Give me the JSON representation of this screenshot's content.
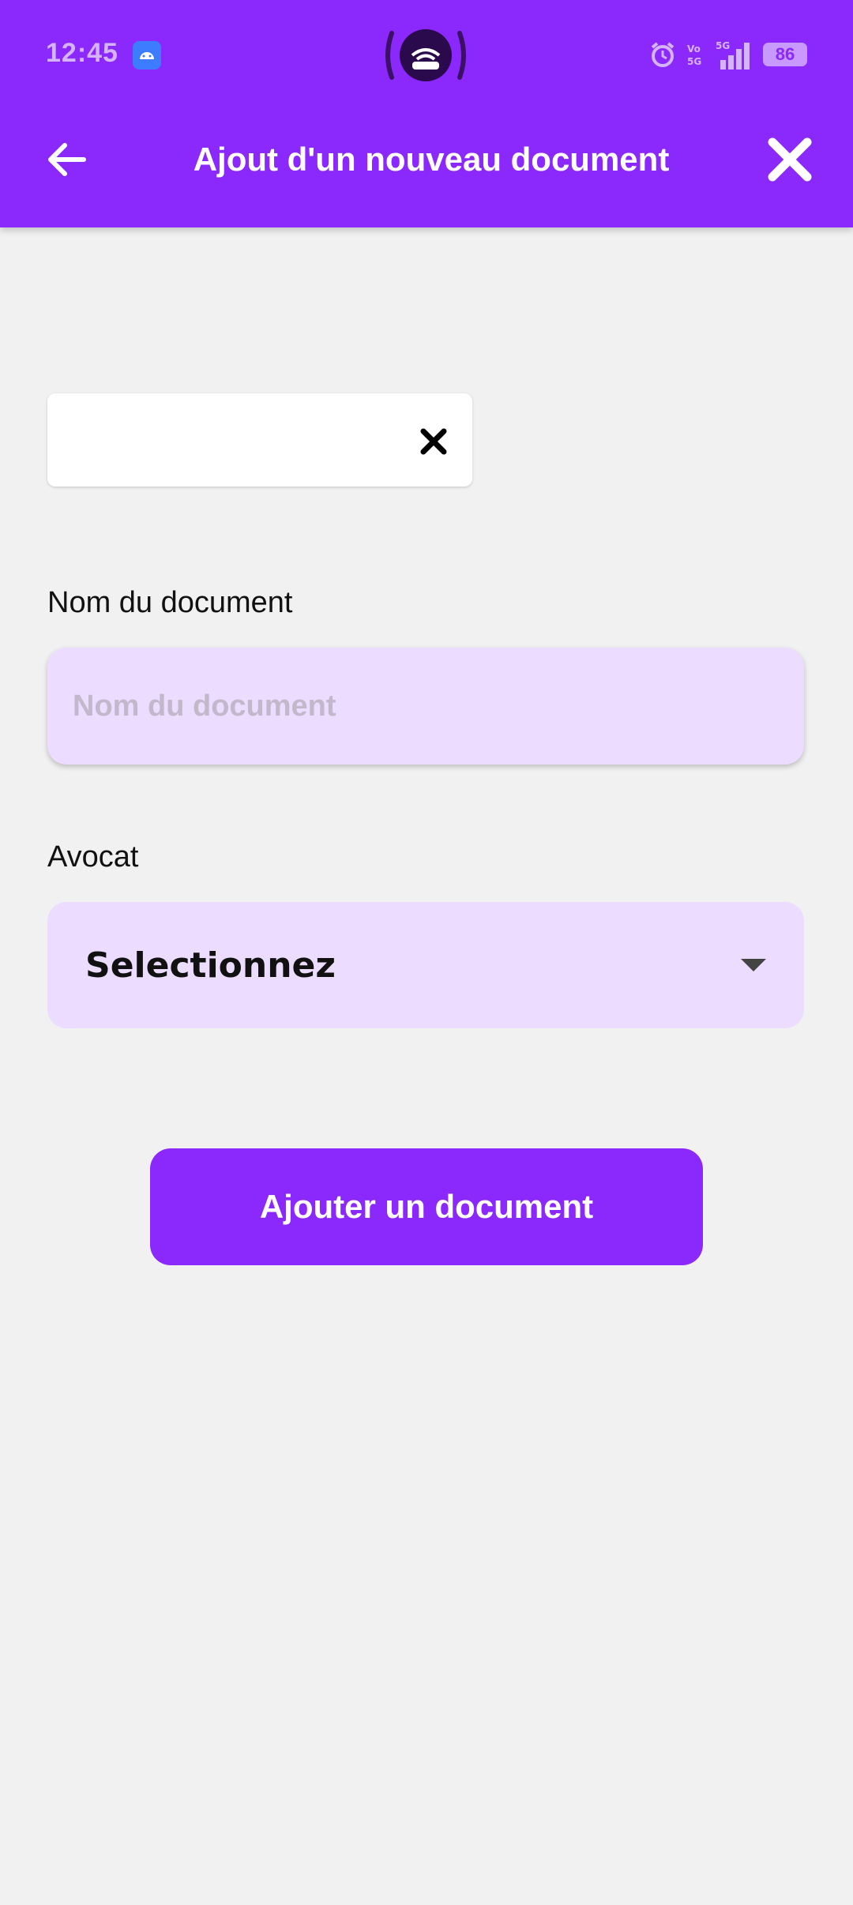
{
  "colors": {
    "accent": "#8b28fc",
    "field_background": "#ecdcff",
    "page_background": "#f2f1f2"
  },
  "status_bar": {
    "time": "12:45",
    "network_label": "5G",
    "volte_label": "Vo 5G",
    "battery": "86",
    "icons": [
      "android-notification-icon",
      "hotspot-cast-icon",
      "alarm-icon",
      "volte-icon",
      "signal-icon",
      "battery-icon"
    ]
  },
  "app_bar": {
    "title": "Ajout d'un nouveau document",
    "back_icon": "arrow-left-icon",
    "close_icon": "close-icon"
  },
  "file_chip": {
    "clear_icon": "close-icon"
  },
  "form": {
    "name_label": "Nom du document",
    "name_placeholder": "Nom du document",
    "name_value": "",
    "lawyer_label": "Avocat",
    "lawyer_selected": "Selectionnez",
    "dropdown_icon": "caret-down-icon",
    "submit_label": "Ajouter un document"
  }
}
